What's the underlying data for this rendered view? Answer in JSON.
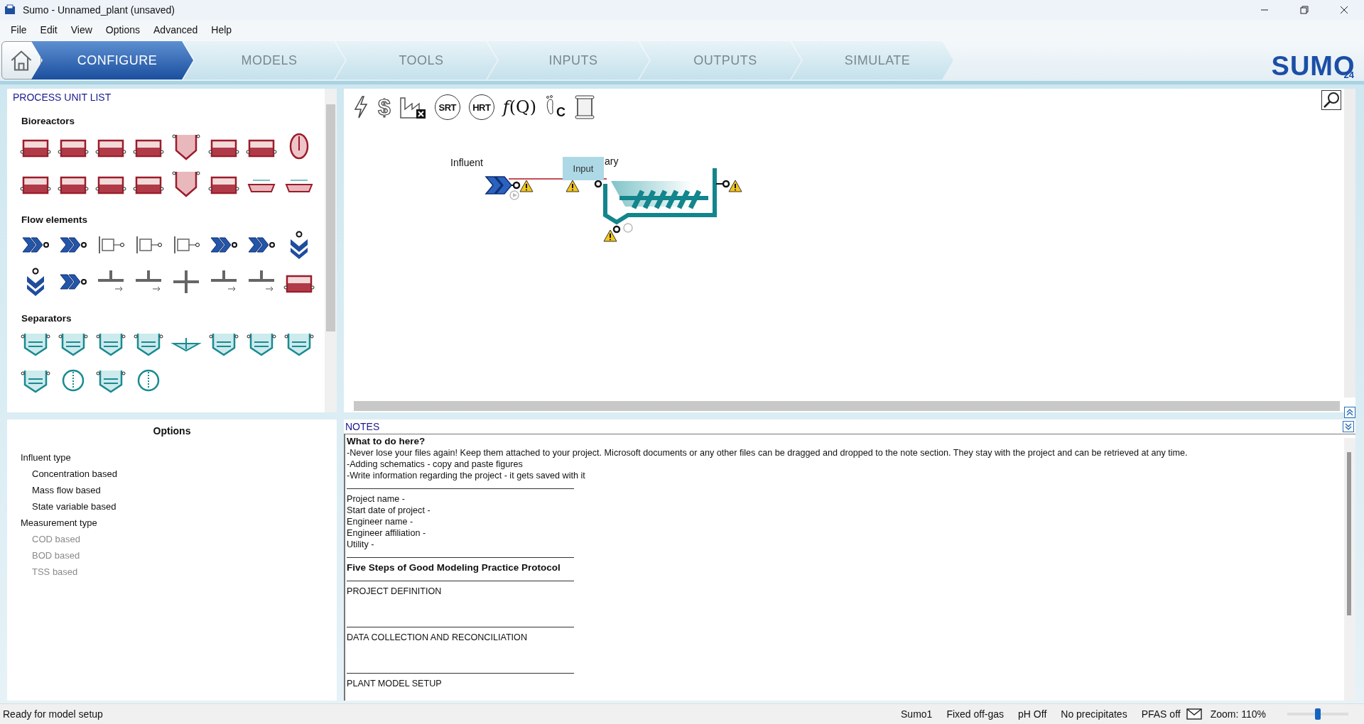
{
  "window": {
    "title": "Sumo - Unnamed_plant (unsaved)"
  },
  "menu": [
    "File",
    "Edit",
    "View",
    "Options",
    "Advanced",
    "Help"
  ],
  "tabs": [
    {
      "label": "CONFIGURE",
      "selected": true
    },
    {
      "label": "MODELS",
      "selected": false
    },
    {
      "label": "TOOLS",
      "selected": false
    },
    {
      "label": "INPUTS",
      "selected": false
    },
    {
      "label": "OUTPUTS",
      "selected": false
    },
    {
      "label": "SIMULATE",
      "selected": false
    }
  ],
  "logo": {
    "text": "SUMO",
    "version": "24"
  },
  "process_unit_list": {
    "title": "PROCESS UNIT LIST",
    "groups": [
      {
        "title": "Bioreactors",
        "icons": [
          {
            "kind": "tank"
          },
          {
            "kind": "tank"
          },
          {
            "kind": "tank"
          },
          {
            "kind": "tank"
          },
          {
            "kind": "hopper"
          },
          {
            "kind": "tank"
          },
          {
            "kind": "tank"
          },
          {
            "kind": "egg"
          },
          {
            "kind": "tank"
          },
          {
            "kind": "tank"
          },
          {
            "kind": "tank"
          },
          {
            "kind": "tank"
          },
          {
            "kind": "hopper"
          },
          {
            "kind": "tank"
          },
          {
            "kind": "basin"
          },
          {
            "kind": "basin"
          }
        ]
      },
      {
        "title": "Flow elements",
        "icons": [
          {
            "kind": "chevron"
          },
          {
            "kind": "chevron"
          },
          {
            "kind": "dosing"
          },
          {
            "kind": "dosing"
          },
          {
            "kind": "dosing"
          },
          {
            "kind": "chevron"
          },
          {
            "kind": "chevron"
          },
          {
            "kind": "down"
          },
          {
            "kind": "down"
          },
          {
            "kind": "chevron"
          },
          {
            "kind": "tee"
          },
          {
            "kind": "tee"
          },
          {
            "kind": "cross"
          },
          {
            "kind": "tee"
          },
          {
            "kind": "tee"
          },
          {
            "kind": "tank"
          }
        ]
      },
      {
        "title": "Separators",
        "icons": [
          {
            "kind": "clarifier"
          },
          {
            "kind": "clarifier"
          },
          {
            "kind": "clarifier"
          },
          {
            "kind": "clarifier"
          },
          {
            "kind": "basin-teal"
          },
          {
            "kind": "clarifier"
          },
          {
            "kind": "clarifier"
          },
          {
            "kind": "clarifier"
          },
          {
            "kind": "clarifier"
          },
          {
            "kind": "drum"
          },
          {
            "kind": "clarifier"
          },
          {
            "kind": "drum"
          }
        ]
      }
    ]
  },
  "options": {
    "title": "Options",
    "groups": [
      {
        "label": "Influent type",
        "children": [
          {
            "label": "Concentration based",
            "disabled": false
          },
          {
            "label": "Mass flow based",
            "disabled": false
          },
          {
            "label": "State variable based",
            "disabled": false
          }
        ]
      },
      {
        "label": "Measurement type",
        "children": [
          {
            "label": "COD based",
            "disabled": true
          },
          {
            "label": "BOD based",
            "disabled": true
          },
          {
            "label": "TSS based",
            "disabled": true
          }
        ]
      }
    ]
  },
  "toolbar": [
    {
      "kind": "bolt"
    },
    {
      "kind": "dollar",
      "label": "$"
    },
    {
      "kind": "factory"
    },
    {
      "kind": "circle",
      "label": "SRT"
    },
    {
      "kind": "circle",
      "label": "HRT"
    },
    {
      "kind": "formula",
      "label": "*f*(Q)"
    },
    {
      "kind": "footprint",
      "label": "C"
    },
    {
      "kind": "scroll"
    }
  ],
  "canvas": {
    "nodes": [
      {
        "kind": "influent",
        "label": "Influent"
      },
      {
        "kind": "clarifier",
        "label": "ary"
      }
    ],
    "tooltip": "Input"
  },
  "notes": {
    "title": "NOTES",
    "lines": [
      {
        "kind": "heading",
        "text": "What to do here?"
      },
      {
        "kind": "text",
        "text": "-Never lose your files again! Keep them attached to your project. Microsoft documents or any other files can be dragged and dropped to the note section. They stay with the project and can be retrieved at any time."
      },
      {
        "kind": "text",
        "text": "-Adding schematics - copy and paste figures"
      },
      {
        "kind": "text",
        "text": "-Write information regarding the project - it gets saved with it"
      },
      {
        "kind": "rule"
      },
      {
        "kind": "text",
        "text": "Project name -"
      },
      {
        "kind": "text",
        "text": "Start date of project -"
      },
      {
        "kind": "text",
        "text": "Engineer name -"
      },
      {
        "kind": "text",
        "text": "Engineer affiliation -"
      },
      {
        "kind": "text",
        "text": "Utility -"
      },
      {
        "kind": "rule"
      },
      {
        "kind": "heading",
        "text": "Five Steps of Good Modeling Practice Protocol"
      },
      {
        "kind": "rule"
      },
      {
        "kind": "text",
        "text": "PROJECT DEFINITION"
      },
      {
        "kind": "blank"
      },
      {
        "kind": "blank"
      },
      {
        "kind": "rule"
      },
      {
        "kind": "text",
        "text": "DATA COLLECTION AND RECONCILIATION"
      },
      {
        "kind": "blank"
      },
      {
        "kind": "blank"
      },
      {
        "kind": "rule"
      },
      {
        "kind": "text",
        "text": "PLANT MODEL SETUP"
      }
    ]
  },
  "status_bar": {
    "message": "Ready for model setup",
    "items": [
      "Sumo1",
      "Fixed off-gas",
      "pH Off",
      "No precipitates",
      "PFAS off"
    ],
    "zoom": "Zoom: 110%",
    "zoom_slider": {
      "level": 0.5
    }
  }
}
